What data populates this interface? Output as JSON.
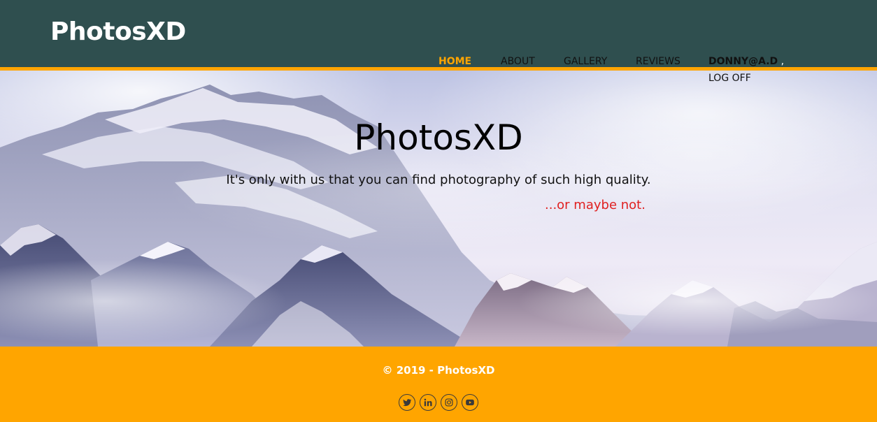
{
  "header": {
    "brand": "PhotosXD",
    "bg_color": "#2f4f4f",
    "accent_color": "#ffa500"
  },
  "nav": {
    "items": [
      {
        "label": "HOME",
        "active": true
      },
      {
        "label": "ABOUT",
        "active": false
      },
      {
        "label": "GALLERY",
        "active": false
      },
      {
        "label": "REVIEWS",
        "active": false
      }
    ],
    "user": {
      "name": "DONNY@A.D",
      "separator": ",",
      "logoff_label": "LOG OFF"
    }
  },
  "hero": {
    "title": "PhotosXD",
    "tagline": "It's only with us that you can find photography of such high quality.",
    "subtagline": "...or maybe not.",
    "subtagline_color": "#e02020",
    "background_icon": "snowy-mountains-image"
  },
  "footer": {
    "copyright": "© 2019 - PhotosXD",
    "bg_color": "#ffa500",
    "socials": [
      {
        "name": "twitter-icon"
      },
      {
        "name": "linkedin-icon"
      },
      {
        "name": "instagram-icon"
      },
      {
        "name": "youtube-icon"
      }
    ]
  }
}
